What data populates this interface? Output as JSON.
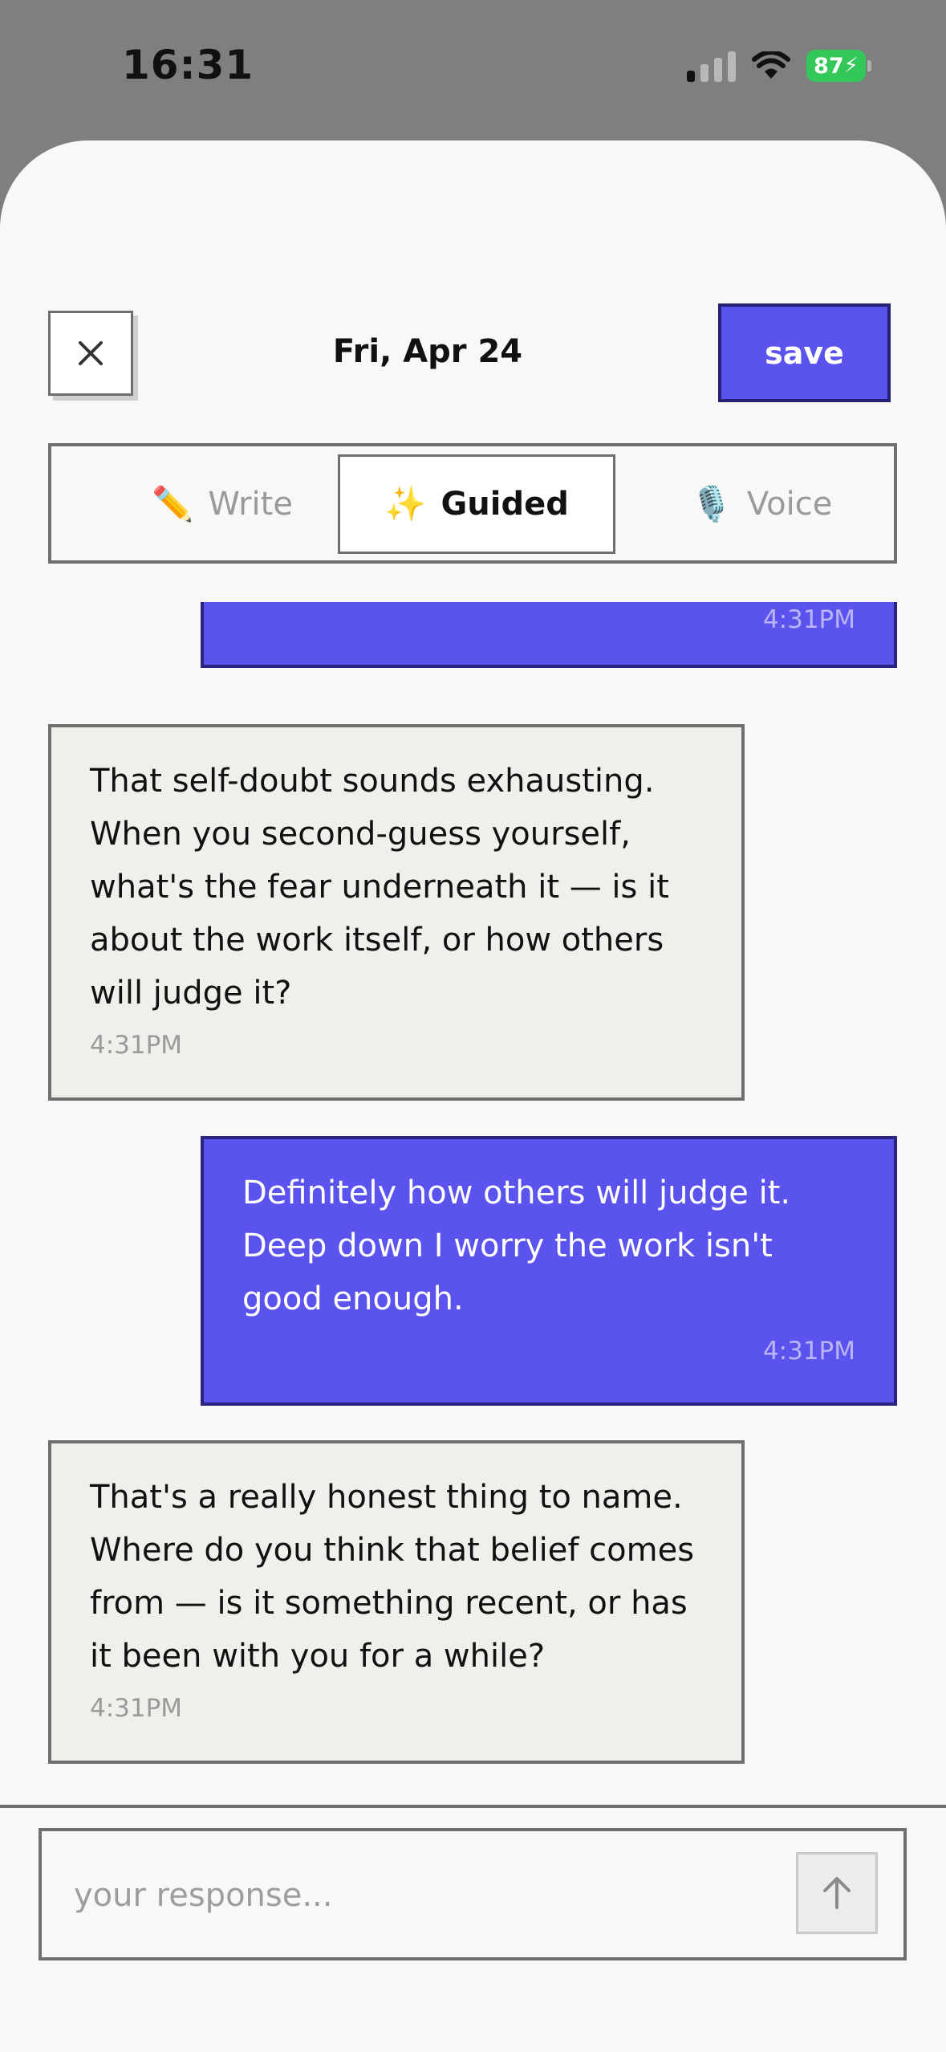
{
  "status_bar": {
    "time": "16:31",
    "battery": "87",
    "icons": [
      "cellular-signal-icon",
      "wifi-icon",
      "battery-charging-icon"
    ]
  },
  "header": {
    "close_icon": "close-icon",
    "date": "Fri, Apr 24",
    "save_label": "save"
  },
  "tabs": [
    {
      "icon": "✏️",
      "label": "Write",
      "active": false
    },
    {
      "icon": "✨",
      "label": "Guided",
      "active": true
    },
    {
      "icon": "🎙️",
      "label": "Voice",
      "active": false
    }
  ],
  "messages": [
    {
      "role": "user",
      "text": "",
      "time": "4:31PM"
    },
    {
      "role": "assistant",
      "text": "That self-doubt sounds exhausting. When you second-guess yourself, what's the fear underneath it — is it about the work itself, or how others will judge it?",
      "time": "4:31PM"
    },
    {
      "role": "user",
      "text": "Definitely how others will judge it. Deep down I worry the work isn't good enough.",
      "time": "4:31PM"
    },
    {
      "role": "assistant",
      "text": "That's a really honest thing to name. Where do you think that belief comes from — is it something recent, or has it been with you for a while?",
      "time": "4:31PM"
    }
  ],
  "composer": {
    "placeholder": "your response...",
    "send_icon": "arrow-up-icon"
  },
  "colors": {
    "accent": "#5b53ee",
    "accent_border": "#272173",
    "assistant_bubble": "#efefeb",
    "sheet_bg": "#f8f8f6",
    "battery_green": "#34c759"
  }
}
